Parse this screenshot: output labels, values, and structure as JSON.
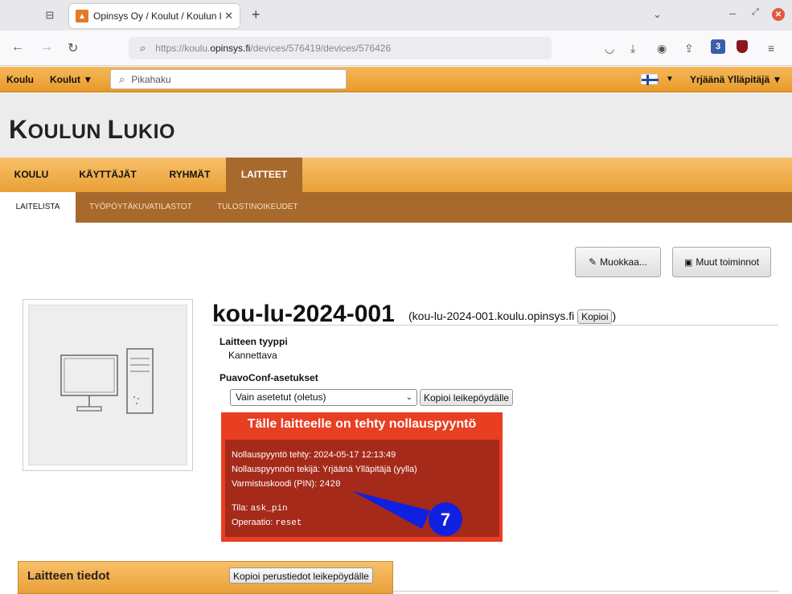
{
  "browser": {
    "tab_title": "Opinsys Oy / Koulut / Koulun lu",
    "url_prefix": "https://koulu.",
    "url_domain": "opinsys.fi",
    "url_path": "/devices/576419/devices/576426",
    "ext_badge": "3"
  },
  "appbar": {
    "home": "Koulu",
    "schools": "Koulut ▼",
    "search_placeholder": "Pikahaku",
    "flag_caret": "▼",
    "user": "Yrjäänä Ylläpitäjä ▼"
  },
  "header": {
    "school_name_first": "K",
    "school_name_rest": "OULUN ",
    "school_name_l": "L",
    "school_name_tail": "UKIO"
  },
  "main_nav": [
    "KOULU",
    "KÄYTTÄJÄT",
    "RYHMÄT",
    "LAITTEET"
  ],
  "sub_nav": [
    "LAITELISTA",
    "TYÖPÖYTÄKUVATILASTOT",
    "TULOSTINOIKEUDET"
  ],
  "actions": {
    "edit": "Muokkaa...",
    "other": "Muut toiminnot"
  },
  "device": {
    "hostname": "kou-lu-2024-001",
    "fqdn_open": "(kou-lu-2024-001.koulu.opinsys.fi",
    "copy": "Kopioi",
    "fqdn_close": ")",
    "type_label": "Laitteen tyyppi",
    "type_value": "Kannettava",
    "puavoconf_label": "PuavoConf-asetukset",
    "puavoconf_select": "Vain asetetut (oletus)",
    "copy_clipboard": "Kopioi leikepöydälle"
  },
  "reset": {
    "heading": "Tälle laitteelle on tehty nollauspyyntö",
    "requested_label": "Nollauspyyntö tehty: ",
    "requested_value": "2024-05-17 12:13:49",
    "requester_label": "Nollauspyynnön tekijä: ",
    "requester_value": "Yrjäänä Ylläpitäjä (yylla)",
    "pin_label": "Varmistuskoodi (PIN): ",
    "pin_value": "2420",
    "state_label": "Tila: ",
    "state_value": "ask_pin",
    "operation_label": "Operaatio: ",
    "operation_value": "reset"
  },
  "callout": {
    "number": "7",
    "color": "#1020e0"
  },
  "info": {
    "title": "Laitteen tiedot",
    "copy_basic": "Kopioi perustiedot leikepöydälle"
  }
}
